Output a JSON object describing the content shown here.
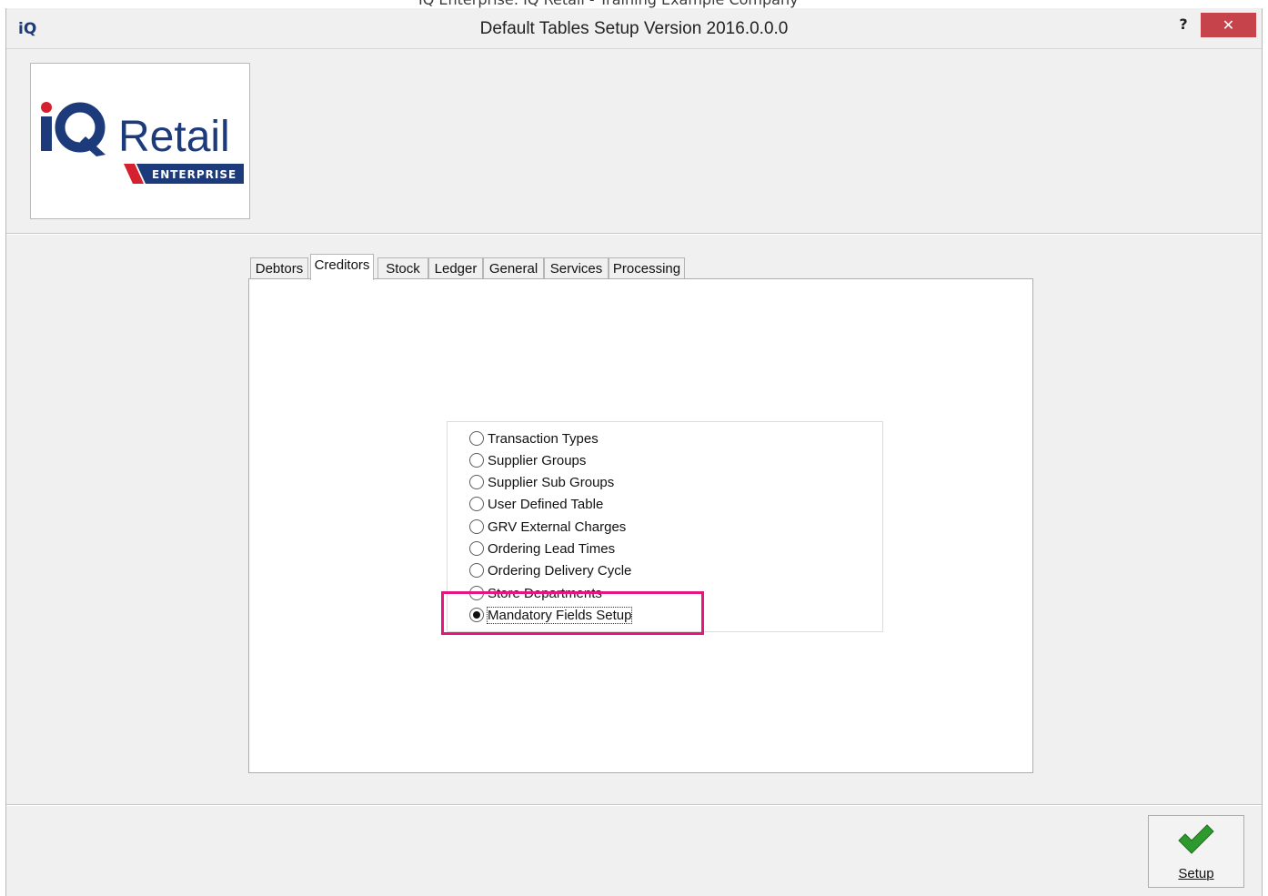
{
  "background_window": {
    "title": "IQ Enterprise: IQ Retail - Training Example Company"
  },
  "window": {
    "app_icon": "iQ",
    "title": "Default Tables Setup Version 2016.0.0.0",
    "help_label": "?",
    "close_label": "✕"
  },
  "logo": {
    "brand_i": "i",
    "brand_q": "Q",
    "brand_word": "Retail",
    "edition": "ENTERPRISE"
  },
  "tabs": [
    {
      "label": "Debtors",
      "active": false
    },
    {
      "label": "Creditors",
      "active": true
    },
    {
      "label": "Stock",
      "active": false
    },
    {
      "label": "Ledger",
      "active": false
    },
    {
      "label": "General",
      "active": false
    },
    {
      "label": "Services",
      "active": false
    },
    {
      "label": "Processing",
      "active": false
    }
  ],
  "options": [
    {
      "label": "Transaction Types",
      "checked": false
    },
    {
      "label": "Supplier Groups",
      "checked": false
    },
    {
      "label": "Supplier Sub Groups",
      "checked": false
    },
    {
      "label": "User Defined Table",
      "checked": false
    },
    {
      "label": "GRV External Charges",
      "checked": false
    },
    {
      "label": "Ordering Lead Times",
      "checked": false
    },
    {
      "label": "Ordering Delivery Cycle",
      "checked": false
    },
    {
      "label": "Store Departments",
      "checked": false
    },
    {
      "label": "Mandatory Fields Setup",
      "checked": true
    }
  ],
  "actions": {
    "setup_label": "Setup"
  },
  "colors": {
    "close_button": "#c7434b",
    "highlight": "#e3177d",
    "check_green": "#2e9a2e",
    "logo_blue": "#1d3b7a",
    "logo_red": "#d4202f"
  }
}
